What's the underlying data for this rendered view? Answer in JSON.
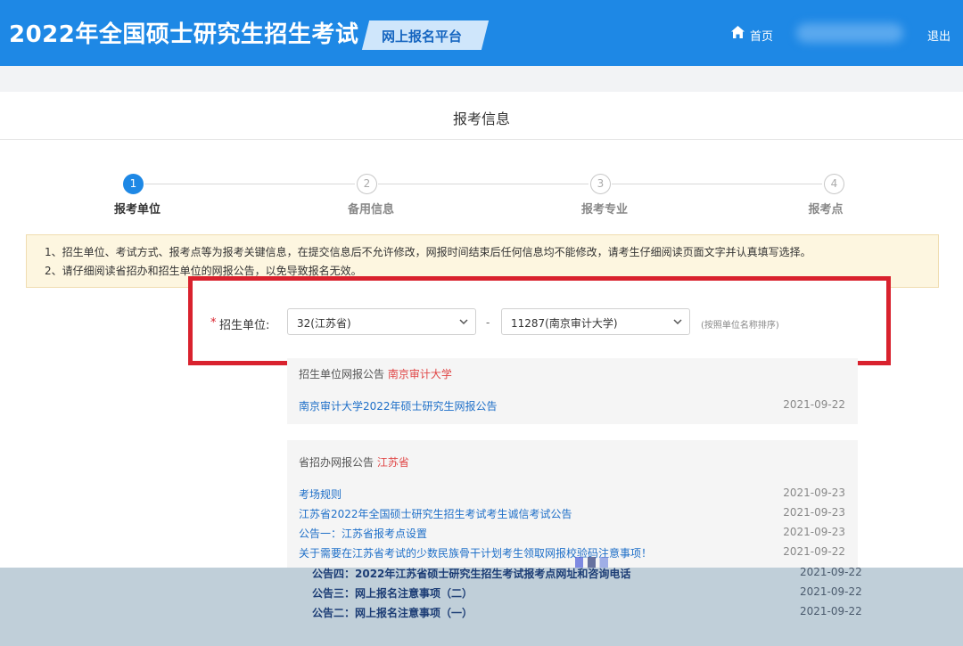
{
  "header": {
    "site_title": "2022年全国硕士研究生招生考试",
    "platform_label": "网上报名平台",
    "home_label": "首页",
    "logout_label": "退出",
    "brand_color": "#1e88e5"
  },
  "page": {
    "title": "报考信息"
  },
  "steps": [
    {
      "number": "1",
      "label": "报考单位",
      "active": true
    },
    {
      "number": "2",
      "label": "备用信息",
      "active": false
    },
    {
      "number": "3",
      "label": "报考专业",
      "active": false
    },
    {
      "number": "4",
      "label": "报考点",
      "active": false
    }
  ],
  "notice": {
    "line1": "1、招生单位、考试方式、报考点等为报考关键信息，在提交信息后不允许修改，网报时间结束后任何信息均不能修改，请考生仔细阅读页面文字并认真填写选择。",
    "line2": "2、请仔细阅读省招办和招生单位的网报公告，以免导致报名无效。"
  },
  "form": {
    "required_mark": "*",
    "field_label": "招生单位:",
    "province_select": "32(江苏省)",
    "separator": "-",
    "school_select": "11287(南京审计大学)",
    "sort_note": "(按照单位名称排序)"
  },
  "school_notices": {
    "header_prefix": "招生单位网报公告",
    "header_school": "南京审计大学",
    "items": [
      {
        "title": "南京审计大学2022年硕士研究生网报公告",
        "date": "2021-09-22"
      }
    ]
  },
  "province_notices": {
    "header_prefix": "省招办网报公告",
    "header_province": "江苏省",
    "items": [
      {
        "title": "考场规则",
        "date": "2021-09-23"
      },
      {
        "title": "江苏省2022年全国硕士研究生招生考试考生诚信考试公告",
        "date": "2021-09-23"
      },
      {
        "title": "公告一：江苏省报考点设置",
        "date": "2021-09-23"
      },
      {
        "title": "关于需要在江苏省考试的少数民族骨干计划考生领取网报校验码注意事项！",
        "date": "2021-09-22"
      }
    ]
  },
  "overlay_notices": [
    {
      "title": "公告四：2022年江苏省硕士研究生招生考试报考点网址和咨询电话",
      "date": "2021-09-22"
    },
    {
      "title": "公告三：网上报名注意事项（二）",
      "date": "2021-09-22"
    },
    {
      "title": "公告二：网上报名注意事项（一）",
      "date": "2021-09-22"
    }
  ]
}
